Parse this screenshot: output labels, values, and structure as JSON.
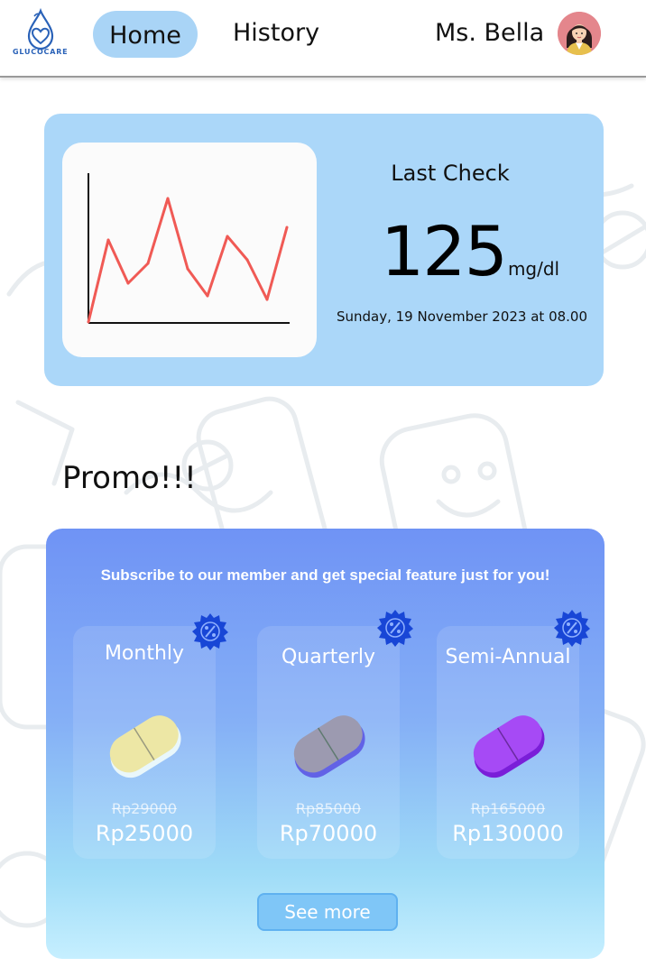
{
  "brand": {
    "logo_text": "GLUCOCARE"
  },
  "nav": {
    "home_label": "Home",
    "history_label": "History",
    "user_name": "Ms. Bella"
  },
  "last_check": {
    "title": "Last Check",
    "value": "125",
    "unit": "mg/dl",
    "date": "Sunday, 19 November 2023 at 08.00"
  },
  "chart_data": {
    "type": "line",
    "title": "",
    "xlabel": "",
    "ylabel": "",
    "x": [
      0,
      1,
      2,
      3,
      4,
      5,
      6,
      7,
      8,
      9,
      10
    ],
    "series": [
      {
        "values": [
          1,
          92,
          44,
          66,
          138,
          60,
          30,
          96,
          70,
          26,
          106
        ],
        "color": "#f05a55"
      }
    ],
    "ylim": [
      0,
      160
    ],
    "grid": false
  },
  "promo": {
    "heading": "Promo!!!",
    "subtitle": "Subscribe to our member and get special feature just for you!",
    "plans": [
      {
        "name": "Monthly",
        "old_price": "Rp29000",
        "new_price": "Rp25000",
        "pill_color": "#ede7a5",
        "pill_icon": "pill-icon"
      },
      {
        "name": "Quarterly",
        "old_price": "Rp85000",
        "new_price": "Rp70000",
        "pill_color": "#9c9ab0",
        "pill_icon": "pill-icon"
      },
      {
        "name": "Semi-Annual",
        "old_price": "Rp165000",
        "new_price": "Rp130000",
        "pill_color": "#a64af5",
        "pill_icon": "pill-icon"
      }
    ],
    "badge_icon": "discount-percent-icon",
    "see_more_label": "See more"
  },
  "colors": {
    "accent": "#a9d4f6",
    "check_card": "#abd7f9",
    "line": "#f05a55",
    "badge": "#1846d6"
  }
}
